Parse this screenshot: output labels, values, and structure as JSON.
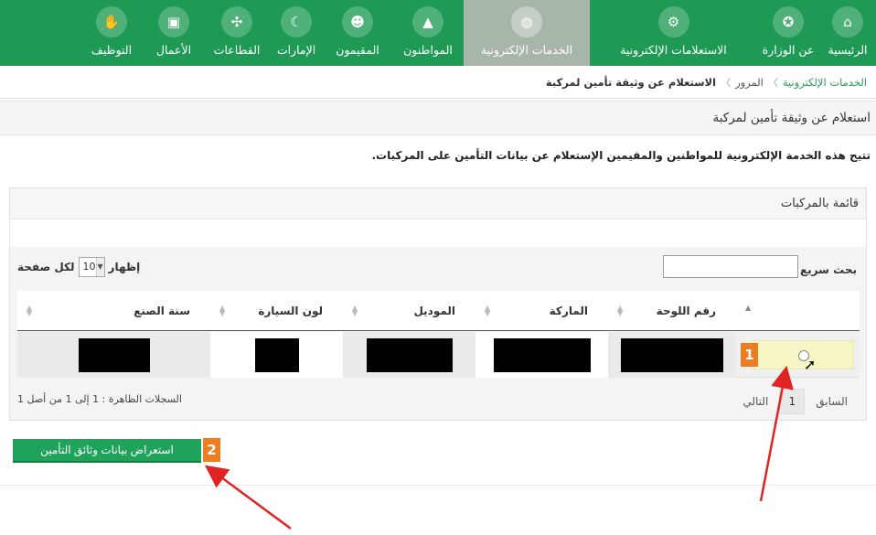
{
  "nav": {
    "items": [
      {
        "label": "الرئيسية",
        "icon": "home-icon",
        "glyph": "⌂"
      },
      {
        "label": "عن الوزارة",
        "icon": "emblem-icon",
        "glyph": "✪"
      },
      {
        "label": "الاستعلامات الإلكترونية",
        "icon": "gear-search-icon",
        "glyph": "⚙"
      },
      {
        "label": "الخدمات الإلكترونية",
        "icon": "globe-icon",
        "glyph": "◍",
        "active": true
      },
      {
        "label": "المواطنون",
        "icon": "citizen-icon",
        "glyph": "▲"
      },
      {
        "label": "المقيمون",
        "icon": "people-icon",
        "glyph": "☻"
      },
      {
        "label": "الإمارات",
        "icon": "emirates-icon",
        "glyph": "☾"
      },
      {
        "label": "القطاعات",
        "icon": "network-icon",
        "glyph": "✣"
      },
      {
        "label": "الأعمال",
        "icon": "briefcase-icon",
        "glyph": "▣"
      },
      {
        "label": "التوظيف",
        "icon": "handshake-icon",
        "glyph": "✋"
      }
    ]
  },
  "breadcrumb": {
    "root": "الخدمات الإلكترونية",
    "middle": "المرور",
    "current": "الاستعلام عن وثيقة تأمين لمركبة",
    "separator": "〉"
  },
  "page_title": "استعلام عن وثيقة تأمين لمركبة",
  "intro": "تتيح هذه الخدمة الإلكترونية للمواطنين والمقيمين الإستعلام عن بيانات التأمين على المركبات.",
  "panel": {
    "title": "قائمة بالمركبات",
    "search_label": "بحث سريع :",
    "search_value": "",
    "show_label": "إظهار",
    "page_size": "10",
    "per_page_label": "لكل صفحة"
  },
  "table": {
    "columns": [
      "",
      "رقم اللوحة",
      "الماركة",
      "الموديل",
      "لون السيارة",
      "سنة الصنع"
    ],
    "row_number": "1"
  },
  "pager": {
    "prev": "السابق",
    "page": "1",
    "next": "التالي",
    "records": "السجلات الظاهرة : 1 إلى 1 من أصل 1"
  },
  "view_button": "استعراض بيانات وثائق التأمين",
  "step2": "2",
  "colors": {
    "nav_green": "#1f9a55",
    "active_tab": "#a8b5a9",
    "button_green": "#1fa35a",
    "step_orange": "#ee7d22",
    "arrow_red": "#e02424"
  }
}
